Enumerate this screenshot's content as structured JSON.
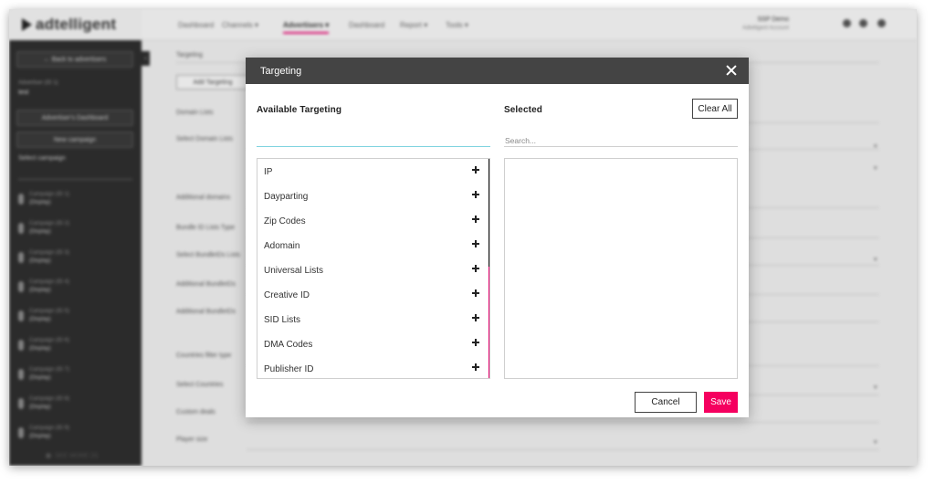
{
  "app": {
    "logo_text": "adtelligent"
  },
  "background": {
    "nav": [
      {
        "label": "Dashboard",
        "active": false
      },
      {
        "label": "Channels ▾",
        "active": false
      },
      {
        "label": "Advertisers ▾",
        "active": true
      },
      {
        "label": "Dashboard",
        "active": false
      },
      {
        "label": "Report ▾",
        "active": false
      },
      {
        "label": "Tools ▾",
        "active": false
      }
    ],
    "account_name": "SSP Demo",
    "account_sub": "Adtelligent Account",
    "sidebar": {
      "back_button": "← Back to advertisers",
      "advertiser_label": "Advertiser (ID 1)",
      "advertiser_value": "test",
      "dashboard_button": "Advertiser's Dashboard",
      "new_campaign_button": "New campaign",
      "select_campaign_label": "Select campaign",
      "campaigns": [
        {
          "name": "Campaign (ID 1)",
          "type": "(Display)"
        },
        {
          "name": "Campaign (ID 2)",
          "type": "(Display)"
        },
        {
          "name": "Campaign (ID 3)",
          "type": "(Display)"
        },
        {
          "name": "Campaign (ID 4)",
          "type": "(Display)"
        },
        {
          "name": "Campaign (ID 5)",
          "type": "(Display)"
        },
        {
          "name": "Campaign (ID 6)",
          "type": "(Display)"
        },
        {
          "name": "Campaign (ID 7)",
          "type": "(Display)"
        },
        {
          "name": "Campaign (ID 8)",
          "type": "(Display)"
        },
        {
          "name": "Campaign (ID 9)",
          "type": "(Display)"
        }
      ],
      "bottom_link": "SEE MORE (9)"
    },
    "form": {
      "targeting_label": "Targeting",
      "add_targeting_button": "Add Targeting",
      "labels": [
        "Domain Lists",
        "Select Domain Lists",
        "Additional domains",
        "Bundle ID Lists Type",
        "Select BundleIDs Lists",
        "Additional BundleIDs",
        "Additional BundleIDs",
        "Countries filter type",
        "Select Countries",
        "Custom deals",
        "Player size"
      ]
    }
  },
  "modal": {
    "title": "Targeting",
    "available_title": "Available Targeting",
    "selected_title": "Selected",
    "clear_all_label": "Clear All",
    "available_filter_value": "",
    "search_placeholder": "Search...",
    "available_items": [
      "IP",
      "Dayparting",
      "Zip Codes",
      "Adomain",
      "Universal Lists",
      "Creative ID",
      "SID Lists",
      "DMA Codes",
      "Publisher ID"
    ],
    "selected_items": [],
    "cancel_label": "Cancel",
    "save_label": "Save",
    "accent_color": "#f5005f",
    "header_color": "#444444"
  }
}
